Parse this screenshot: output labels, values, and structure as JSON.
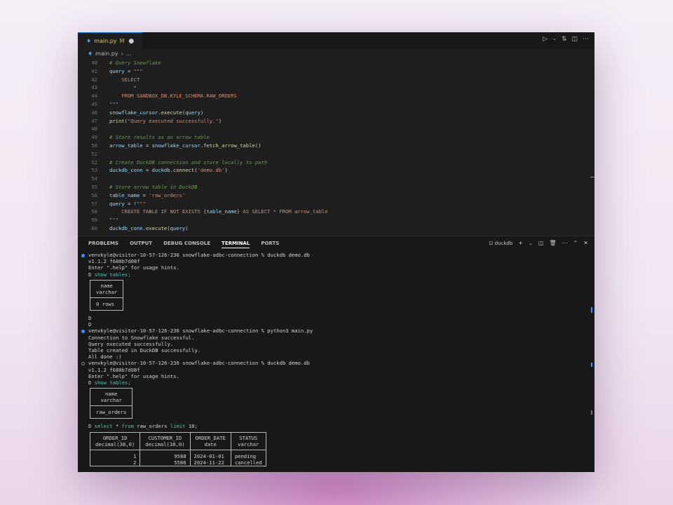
{
  "tab": {
    "icon": "python-file-icon",
    "filename": "main.py",
    "status": "M"
  },
  "breadcrumb": {
    "file": "main.py",
    "rest": "..."
  },
  "code_lines": [
    {
      "n": "40",
      "segs": [
        [
          "c-com",
          "# Query Snowflake"
        ]
      ]
    },
    {
      "n": "41",
      "segs": [
        [
          "c-var",
          "query"
        ],
        [
          "c-op",
          " = "
        ],
        [
          "c-str",
          "\"\"\""
        ]
      ]
    },
    {
      "n": "42",
      "segs": [
        [
          "c-sql",
          "    SELECT"
        ]
      ]
    },
    {
      "n": "43",
      "segs": [
        [
          "c-sql",
          "        *"
        ]
      ]
    },
    {
      "n": "44",
      "segs": [
        [
          "c-sql",
          "    FROM SANDBOX_DB.KYLE_SCHEMA.RAW_ORDERS"
        ]
      ]
    },
    {
      "n": "45",
      "segs": [
        [
          "c-str",
          "\"\"\""
        ]
      ]
    },
    {
      "n": "46",
      "segs": [
        [
          "c-var",
          "snowflake_cursor"
        ],
        [
          "c-op",
          "."
        ],
        [
          "c-fn",
          "execute"
        ],
        [
          "c-op",
          "("
        ],
        [
          "c-var",
          "query"
        ],
        [
          "c-op",
          ")"
        ]
      ]
    },
    {
      "n": "47",
      "segs": [
        [
          "c-fn",
          "print"
        ],
        [
          "c-op",
          "("
        ],
        [
          "c-str",
          "\"Query executed successfully.\""
        ],
        [
          "c-op",
          ")"
        ]
      ]
    },
    {
      "n": "48",
      "segs": []
    },
    {
      "n": "49",
      "segs": [
        [
          "c-com",
          "# Store results as an arrow table"
        ]
      ]
    },
    {
      "n": "50",
      "segs": [
        [
          "c-var",
          "arrow_table"
        ],
        [
          "c-op",
          " = "
        ],
        [
          "c-var",
          "snowflake_cursor"
        ],
        [
          "c-op",
          "."
        ],
        [
          "c-fn",
          "fetch_arrow_table"
        ],
        [
          "c-op",
          "()"
        ]
      ]
    },
    {
      "n": "51",
      "segs": []
    },
    {
      "n": "52",
      "segs": [
        [
          "c-com",
          "# Create DuckDB connection and store locally to path"
        ]
      ]
    },
    {
      "n": "53",
      "segs": [
        [
          "c-var",
          "duckdb_conn"
        ],
        [
          "c-op",
          " = "
        ],
        [
          "c-var",
          "duckdb"
        ],
        [
          "c-op",
          "."
        ],
        [
          "c-fn",
          "connect"
        ],
        [
          "c-op",
          "("
        ],
        [
          "c-str",
          "'demo.db'"
        ],
        [
          "c-op",
          ")"
        ]
      ]
    },
    {
      "n": "54",
      "segs": []
    },
    {
      "n": "55",
      "segs": [
        [
          "c-com",
          "# Store arrow table in DuckDB"
        ]
      ]
    },
    {
      "n": "56",
      "segs": [
        [
          "c-var",
          "table_name"
        ],
        [
          "c-op",
          " = "
        ],
        [
          "c-str",
          "'raw_orders'"
        ]
      ]
    },
    {
      "n": "57",
      "segs": [
        [
          "c-var",
          "query"
        ],
        [
          "c-op",
          " = "
        ],
        [
          "c-kw",
          "f"
        ],
        [
          "c-str",
          "\"\"\""
        ]
      ]
    },
    {
      "n": "58",
      "segs": [
        [
          "c-sql",
          "    CREATE TABLE IF NOT EXISTS "
        ],
        [
          "c-br",
          "{"
        ],
        [
          "c-var",
          "table_name"
        ],
        [
          "c-br",
          "}"
        ],
        [
          "c-sql",
          " AS SELECT * FROM arrow_table"
        ]
      ]
    },
    {
      "n": "59",
      "segs": [
        [
          "c-str",
          "\"\"\""
        ]
      ]
    },
    {
      "n": "60",
      "segs": [
        [
          "c-var",
          "duckdb_conn"
        ],
        [
          "c-op",
          "."
        ],
        [
          "c-fn",
          "execute"
        ],
        [
          "c-op",
          "("
        ],
        [
          "c-var",
          "query"
        ],
        [
          "c-op",
          ")"
        ]
      ]
    }
  ],
  "panel": {
    "tabs": [
      "PROBLEMS",
      "OUTPUT",
      "DEBUG CONSOLE",
      "TERMINAL",
      "PORTS"
    ],
    "active_tab": "TERMINAL",
    "terminal_name": "duckdb"
  },
  "terminal": {
    "prompt1": "venvkyle@visitor-10-57-126-236 snowflake-adbc-connection % duckdb demo.db",
    "version": "v1.1.2 f680b7d08f",
    "help": "Enter \".help\" for usage hints.",
    "d_prompt": "D",
    "show_tables": "show tables;",
    "tbl1_h1": "name",
    "tbl1_h2": "varchar",
    "tbl1_rows": "0 rows",
    "prompt2": "venvkyle@visitor-10-57-126-236 snowflake-adbc-connection % python3 main.py",
    "out1": "Connection to Snowflake successful.",
    "out2": "Query executed successfully.",
    "out3": "Table created in DuckDB successfully.",
    "out4": "All done :)",
    "prompt3": "venvkyle@visitor-10-57-126-236 snowflake-adbc-connection % duckdb demo.db",
    "tbl2_val": "raw_orders",
    "select_kw1": "select",
    "select_star": " * ",
    "select_kw2": "from",
    "select_tbl": " raw_orders ",
    "select_kw3": "limit",
    "select_end": " 10;",
    "orders": {
      "columns": [
        {
          "name": "ORDER_ID",
          "type": "decimal(38,0)"
        },
        {
          "name": "CUSTOMER_ID",
          "type": "decimal(38,0)"
        },
        {
          "name": "ORDER_DATE",
          "type": "date"
        },
        {
          "name": "STATUS",
          "type": "varchar"
        }
      ],
      "rows": [
        [
          "1",
          "9588",
          "2024-01-01",
          "pending"
        ],
        [
          "2",
          "5586",
          "2024-11-22",
          "cancelled"
        ]
      ]
    }
  }
}
